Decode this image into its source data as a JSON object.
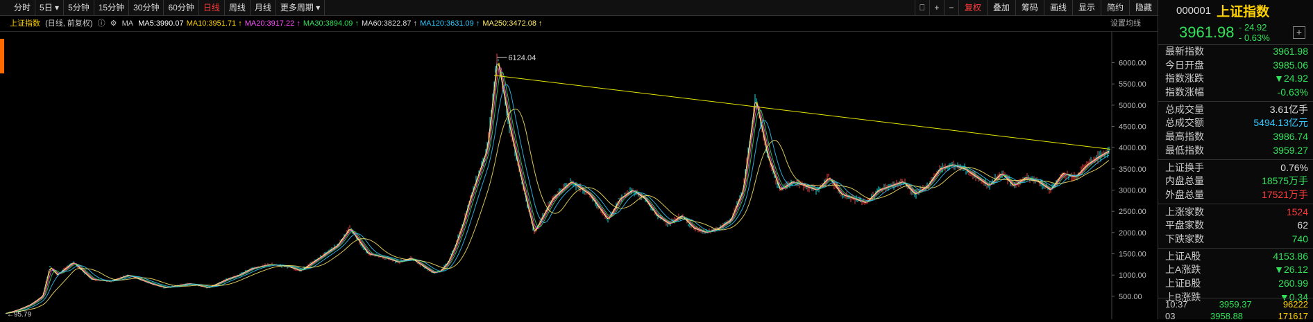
{
  "toolbar": {
    "periods": [
      "分时",
      "5日",
      "5分钟",
      "15分钟",
      "30分钟",
      "60分钟",
      "日线",
      "周线",
      "月线",
      "更多周期"
    ],
    "active": "日线",
    "right": [
      "复权",
      "叠加",
      "筹码",
      "画线",
      "显示",
      "简约",
      "隐藏"
    ]
  },
  "infobar": {
    "title": "上证指数",
    "subtitle": "(日线, 前复权)",
    "ma_label": "MA",
    "ma": [
      {
        "text": "MA5:3990.07",
        "color": "#ffffff"
      },
      {
        "text": "MA10:3951.71",
        "color": "#ffd200"
      },
      {
        "text": "MA20:3917.22",
        "color": "#ff4fff"
      },
      {
        "text": "MA30:3894.09",
        "color": "#33e25a"
      },
      {
        "text": "MA60:3822.87",
        "color": "#dddddd"
      },
      {
        "text": "MA120:3631.09",
        "color": "#33c8ff"
      },
      {
        "text": "MA250:3472.08",
        "color": "#ffea6a"
      }
    ],
    "settings": "设置均线"
  },
  "chart_data": {
    "type": "line",
    "title": "上证指数",
    "y_ticks": [
      6000,
      5500,
      5000,
      4500,
      4000,
      3500,
      3000,
      2500,
      2000,
      1500,
      1000,
      500
    ],
    "y_tick_labels": [
      "6000.00",
      "5500.00",
      "5000.00",
      "4500.00",
      "4000.00",
      "3500.00",
      "3000.00",
      "2500.00",
      "2000.00",
      "1500.00",
      "1000.00",
      "500.00"
    ],
    "ylim": [
      90,
      6400
    ],
    "high_label": "6124.04",
    "low_label": "95.79",
    "index_x": [
      0,
      10,
      20,
      30,
      36,
      42,
      55,
      70,
      85,
      100,
      118,
      130,
      150,
      165,
      180,
      190,
      200,
      215,
      230,
      240,
      255,
      270,
      280,
      295,
      310,
      320,
      330,
      340,
      348,
      354,
      360,
      366,
      372,
      378,
      385,
      392,
      400,
      410,
      420,
      430,
      445,
      460,
      475,
      490,
      500,
      510,
      520,
      530,
      540,
      550,
      560,
      570,
      580,
      590,
      600,
      610,
      620,
      630,
      640,
      650,
      660,
      670,
      680,
      690,
      700,
      710,
      720,
      730,
      740,
      750,
      760,
      770,
      780,
      790,
      800,
      810,
      820,
      830,
      840,
      850,
      860,
      870,
      880,
      890,
      900
    ],
    "index_y": [
      96,
      180,
      300,
      500,
      1200,
      1000,
      1300,
      900,
      850,
      1000,
      800,
      700,
      800,
      700,
      900,
      1000,
      1150,
      1250,
      1200,
      1100,
      1400,
      1700,
      2100,
      1500,
      1400,
      1300,
      1400,
      1200,
      1050,
      1100,
      1300,
      1700,
      2200,
      2800,
      3400,
      4000,
      6124,
      4500,
      3200,
      2000,
      2800,
      3200,
      2900,
      2300,
      2800,
      3000,
      2800,
      2400,
      2200,
      2400,
      2100,
      2000,
      2100,
      2300,
      3000,
      5178,
      3800,
      3000,
      3200,
      3100,
      3000,
      3300,
      2900,
      2800,
      2700,
      3000,
      3100,
      3200,
      2900,
      3100,
      3500,
      3600,
      3500,
      3300,
      3100,
      3400,
      3100,
      3300,
      3200,
      3000,
      3400,
      3300,
      3600,
      3800,
      3962
    ],
    "trendline": {
      "from": [
        5700,
        "start"
      ],
      "to": [
        3962,
        "end"
      ]
    }
  },
  "panel": {
    "code": "000001",
    "name": "上证指数",
    "price": "3961.98",
    "change": "- 24.92",
    "pct": "- 0.63%",
    "rows": [
      {
        "k": "最新指数",
        "v": "3961.98",
        "c": "#33e25a"
      },
      {
        "k": "今日开盘",
        "v": "3985.06",
        "c": "#33e25a"
      },
      {
        "k": "指数涨跌",
        "v": "▼24.92",
        "c": "#33e25a"
      },
      {
        "k": "指数涨幅",
        "v": "-0.63%",
        "c": "#33e25a"
      },
      {
        "k": "总成交量",
        "v": "3.61亿手",
        "c": "#dddddd"
      },
      {
        "k": "总成交额",
        "v": "5494.13亿元",
        "c": "#33c8ff"
      },
      {
        "k": "最高指数",
        "v": "3986.74",
        "c": "#33e25a"
      },
      {
        "k": "最低指数",
        "v": "3959.27",
        "c": "#33e25a"
      },
      {
        "k": "上证换手",
        "v": "0.76%",
        "c": "#dddddd"
      },
      {
        "k": "内盘总量",
        "v": "18575万手",
        "c": "#33e25a"
      },
      {
        "k": "外盘总量",
        "v": "17521万手",
        "c": "#ff3b3b"
      },
      {
        "k": "上涨家数",
        "v": "1524",
        "c": "#ff3b3b"
      },
      {
        "k": "平盘家数",
        "v": "62",
        "c": "#dddddd"
      },
      {
        "k": "下跌家数",
        "v": "740",
        "c": "#33e25a"
      },
      {
        "k": "上证A股",
        "v": "4153.86",
        "c": "#33e25a"
      },
      {
        "k": "上A涨跌",
        "v": "▼26.12",
        "c": "#33e25a"
      },
      {
        "k": "上证B股",
        "v": "260.99",
        "c": "#33e25a"
      },
      {
        "k": "上B涨跌",
        "v": "▼0.34",
        "c": "#33e25a"
      }
    ],
    "foot": [
      {
        "t": "10:37",
        "p": "3959.37",
        "v": "96222"
      },
      {
        "t": "03",
        "p": "3958.88",
        "v": "171617"
      }
    ]
  }
}
